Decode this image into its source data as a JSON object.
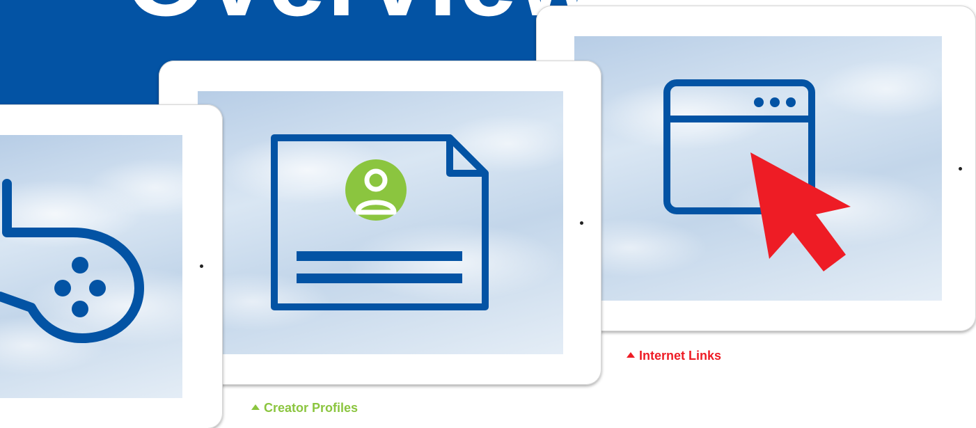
{
  "banner": {
    "title": "Overview",
    "color": "#0353a4"
  },
  "tablets": [
    {
      "name": "game",
      "icon": "game-controller-icon"
    },
    {
      "name": "profile",
      "icon": "profile-document-icon"
    },
    {
      "name": "link",
      "icon": "browser-window-cursor-icon"
    }
  ],
  "captions": {
    "creator_profiles": {
      "label": "Creator Profiles",
      "color": "#8bc53f"
    },
    "internet_links": {
      "label": "Internet Links",
      "color": "#ee1c25"
    }
  },
  "colors": {
    "icon_blue": "#0353a4",
    "profile_green": "#8bc53f",
    "cursor_red": "#ee1c25"
  }
}
